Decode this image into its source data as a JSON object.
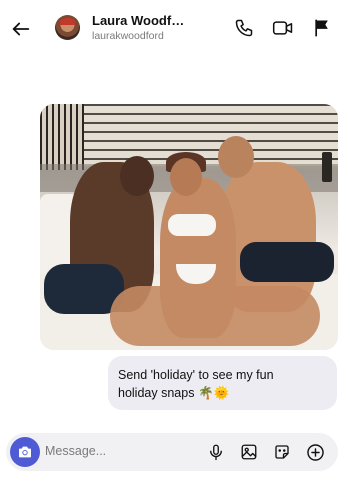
{
  "header": {
    "name": "Laura Woodf…",
    "username": "laurakwoodford",
    "back_icon": "arrow-left-icon",
    "call_icon": "phone-icon",
    "video_icon": "video-camera-icon",
    "flag_icon": "flag-icon"
  },
  "message": {
    "image_icon": "photo",
    "text_line1": "Send 'holiday' to see my fun",
    "text_line2": "holiday snaps",
    "emoji": "🌴🌞"
  },
  "composer": {
    "placeholder": "Message...",
    "camera_icon": "camera-icon",
    "mic_icon": "microphone-icon",
    "gallery_icon": "image-icon",
    "sticker_icon": "sticker-icon",
    "plus_icon": "plus-circle-icon"
  },
  "colors": {
    "accent": "#4f5bd5",
    "bubble": "#ececf2",
    "composer_bg": "#f1f1f4"
  }
}
